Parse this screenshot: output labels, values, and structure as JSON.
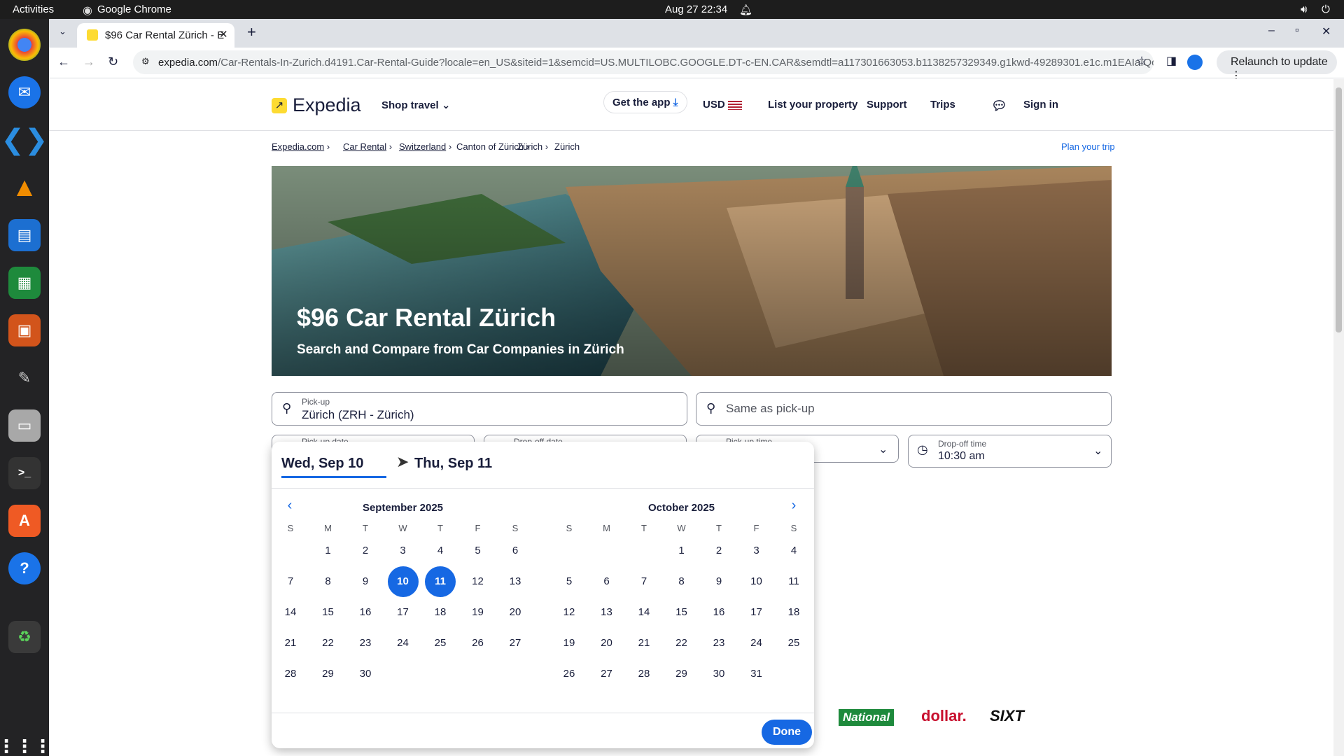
{
  "system": {
    "activities": "Activities",
    "app_name": "Google Chrome",
    "datetime": "Aug 27  22:34"
  },
  "browser": {
    "tab_title": "$96 Car Rental Zürich - E",
    "url_host": "expedia.com",
    "url_path": "/Car-Rentals-In-Zurich.d4191.Car-Rental-Guide?locale=en_US&siteid=1&semcid=US.MULTILOBC.GOOGLE.DT-c-EN.CAR&semdtl=a117301663053.b1138257329349.g1kwd-49289301.e1c.m1EAIaIQobChMIw...",
    "relaunch": "Relaunch to update"
  },
  "header": {
    "logo": "Expedia",
    "shop_travel": "Shop travel",
    "get_app": "Get the app",
    "currency": "USD",
    "list_property": "List your property",
    "support": "Support",
    "trips": "Trips",
    "sign_in": "Sign in"
  },
  "breadcrumb": {
    "items": [
      "Expedia.com",
      "Car Rental",
      "Switzerland",
      "Canton of Zürich",
      "Zürich",
      "Zürich"
    ],
    "plan_trip": "Plan your trip"
  },
  "hero": {
    "title": "$96 Car Rental Zürich",
    "subtitle": "Search and Compare from Car Companies in Zürich"
  },
  "search": {
    "pickup_label": "Pick-up",
    "pickup_value": "Zürich (ZRH - Zürich)",
    "dropoff_value": "Same as pick-up",
    "pickup_date_label": "Pick-up date",
    "dropoff_date_label": "Drop-off date",
    "pickup_time_label": "Pick-up time",
    "dropoff_time_label": "Drop-off time",
    "dropoff_time_value": "10:30 am"
  },
  "datepicker": {
    "start": "Wed, Sep 10",
    "end": "Thu, Sep 11",
    "done": "Done",
    "weekdays": [
      "S",
      "M",
      "T",
      "W",
      "T",
      "F",
      "S"
    ],
    "months": [
      {
        "title": "September 2025",
        "first_weekday": 1,
        "days": 30,
        "selected": [
          10,
          11
        ]
      },
      {
        "title": "October 2025",
        "first_weekday": 3,
        "days": 31,
        "selected": []
      }
    ]
  },
  "partners": [
    "National",
    "dollar.",
    "SIXT"
  ],
  "colors": {
    "accent": "#1668e3",
    "brand_yellow": "#fddb32",
    "text": "#191e3b"
  }
}
